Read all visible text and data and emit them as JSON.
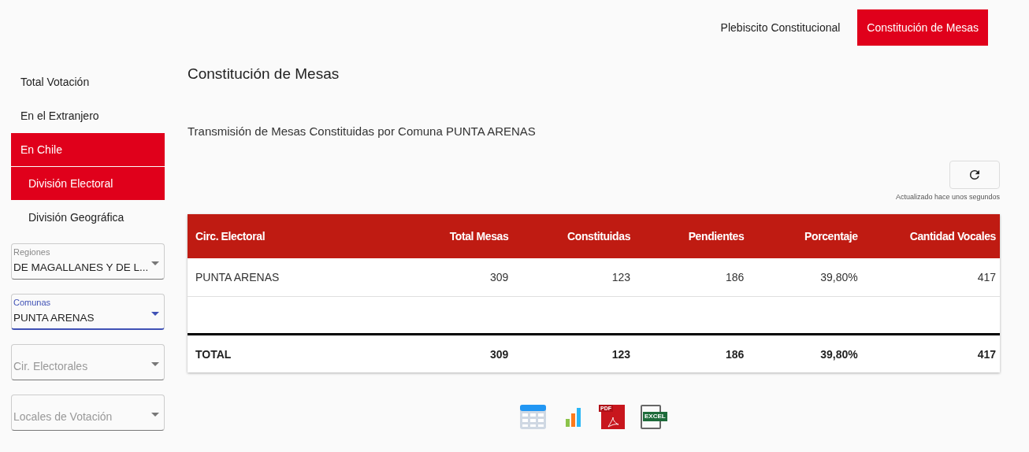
{
  "top_tabs": [
    {
      "label": "Plebiscito Constitucional",
      "selected": false
    },
    {
      "label": "Constitución de Mesas",
      "selected": true
    }
  ],
  "sidebar": {
    "items": [
      {
        "label": "Total Votación",
        "selected": false
      },
      {
        "label": "En el Extranjero",
        "selected": false
      },
      {
        "label": "En Chile",
        "selected": true,
        "children": [
          {
            "label": "División Electoral",
            "selected": true
          },
          {
            "label": "División Geográfica",
            "selected": false
          }
        ]
      }
    ],
    "selects": [
      {
        "label": "Regiones",
        "value": "DE MAGALLANES Y DE L...",
        "focused": false
      },
      {
        "label": "Comunas",
        "value": "PUNTA ARENAS",
        "focused": true
      },
      {
        "placeholder": "Cir. Electorales",
        "focused": false
      },
      {
        "placeholder": "Locales de Votación",
        "focused": false
      }
    ]
  },
  "title": "Constitución de Mesas",
  "subtitle": "Transmisión de Mesas Constituidas por Comuna PUNTA ARENAS",
  "updated": "Actualizado hace unos segundos",
  "table": {
    "columns": [
      "Circ. Electoral",
      "Total Mesas",
      "Constituidas",
      "Pendientes",
      "Porcentaje",
      "Cantidad Vocales"
    ],
    "rows": [
      [
        "PUNTA ARENAS",
        "309",
        "123",
        "186",
        "39,80%",
        "417"
      ]
    ],
    "total": [
      "TOTAL",
      "309",
      "123",
      "186",
      "39,80%",
      "417"
    ]
  },
  "exports": [
    {
      "kind": "table"
    },
    {
      "kind": "chart"
    },
    {
      "kind": "pdf",
      "label": "PDF"
    },
    {
      "kind": "excel",
      "label": "EXCEL"
    }
  ]
}
